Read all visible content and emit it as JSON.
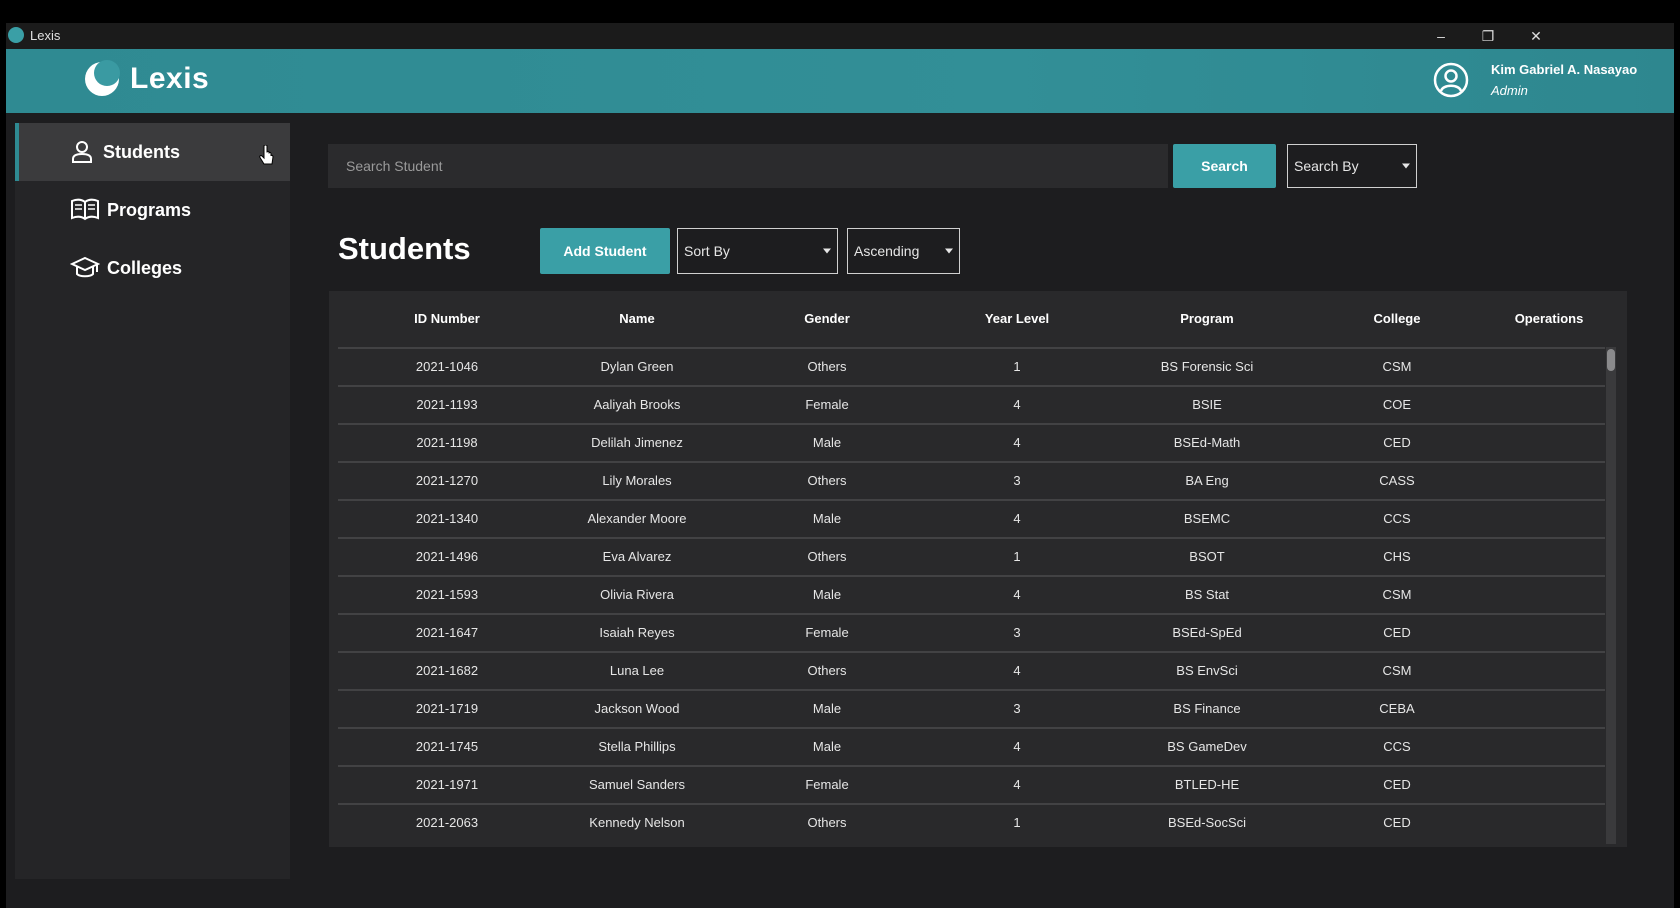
{
  "window": {
    "title": "Lexis"
  },
  "header": {
    "logo_text": "Lexis",
    "user_name": "Kim Gabriel A. Nasayao",
    "user_role": "Admin"
  },
  "sidebar": {
    "items": [
      {
        "label": "Students",
        "icon": "person-icon",
        "active": true
      },
      {
        "label": "Programs",
        "icon": "book-icon",
        "active": false
      },
      {
        "label": "Colleges",
        "icon": "graduation-cap-icon",
        "active": false
      }
    ]
  },
  "search": {
    "placeholder": "Search Student",
    "button_label": "Search",
    "search_by": "Search By"
  },
  "main": {
    "title": "Students",
    "add_button": "Add Student",
    "sort_by": "Sort By",
    "order": "Ascending"
  },
  "table": {
    "columns": [
      "ID Number",
      "Name",
      "Gender",
      "Year Level",
      "Program",
      "College",
      "Operations"
    ],
    "rows": [
      [
        "2021-1046",
        "Dylan Green",
        "Others",
        "1",
        "BS Forensic Sci",
        "CSM"
      ],
      [
        "2021-1193",
        "Aaliyah Brooks",
        "Female",
        "4",
        "BSIE",
        "COE"
      ],
      [
        "2021-1198",
        "Delilah Jimenez",
        "Male",
        "4",
        "BSEd-Math",
        "CED"
      ],
      [
        "2021-1270",
        "Lily Morales",
        "Others",
        "3",
        "BA Eng",
        "CASS"
      ],
      [
        "2021-1340",
        "Alexander Moore",
        "Male",
        "4",
        "BSEMC",
        "CCS"
      ],
      [
        "2021-1496",
        "Eva Alvarez",
        "Others",
        "1",
        "BSOT",
        "CHS"
      ],
      [
        "2021-1593",
        "Olivia Rivera",
        "Male",
        "4",
        "BS Stat",
        "CSM"
      ],
      [
        "2021-1647",
        "Isaiah Reyes",
        "Female",
        "3",
        "BSEd-SpEd",
        "CED"
      ],
      [
        "2021-1682",
        "Luna Lee",
        "Others",
        "4",
        "BS EnvSci",
        "CSM"
      ],
      [
        "2021-1719",
        "Jackson Wood",
        "Male",
        "3",
        "BS Finance",
        "CEBA"
      ],
      [
        "2021-1745",
        "Stella Phillips",
        "Male",
        "4",
        "BS GameDev",
        "CCS"
      ],
      [
        "2021-1971",
        "Samuel Sanders",
        "Female",
        "4",
        "BTLED-HE",
        "CED"
      ],
      [
        "2021-2063",
        "Kennedy Nelson",
        "Others",
        "1",
        "BSEd-SocSci",
        "CED"
      ]
    ]
  },
  "colors": {
    "accent": "#3a9fa6",
    "header": "#2f8a92",
    "background": "#1d1d1f",
    "sidebar": "#252527"
  }
}
